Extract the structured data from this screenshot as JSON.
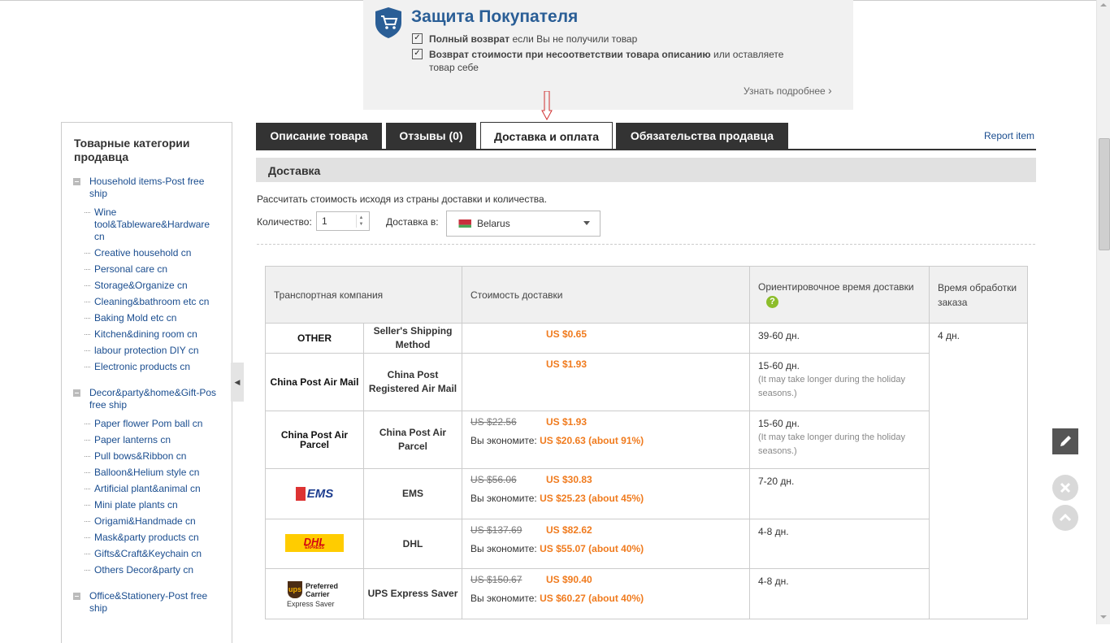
{
  "protection": {
    "title": "Защита Покупателя",
    "line1_bold": "Полный возврат",
    "line1_rest": " если Вы не получили товар",
    "line2_bold": "Возврат стоимости при несоответствии товара описанию",
    "line2_rest": " или оставляете товар себе",
    "more": "Узнать подробнее",
    "more_arrow": "›"
  },
  "sidebar": {
    "title": "Товарные категории продавца",
    "groups": [
      {
        "label": "Household items-Post free ship",
        "items": [
          "Wine tool&Tableware&Hardware cn",
          "Creative household cn",
          "Personal care cn",
          "Storage&Organize cn",
          "Cleaning&bathroom etc cn",
          "Baking Mold etc cn",
          "Kitchen&dining room cn",
          "labour protection DIY cn",
          "Electronic products cn"
        ]
      },
      {
        "label": "Decor&party&home&Gift-Pos free ship",
        "items": [
          "Paper flower Pom ball cn",
          "Paper lanterns cn",
          "Pull bows&Ribbon cn",
          "Balloon&Helium style cn",
          "Artificial plant&animal cn",
          "Mini plate plants cn",
          "Origami&Handmade cn",
          "Mask&party products cn",
          "Gifts&Craft&Keychain cn",
          "Others Decor&party cn"
        ]
      },
      {
        "label": "Office&Stationery-Post free ship",
        "items": []
      }
    ],
    "collapse_glyph": "◀"
  },
  "tabs": [
    "Описание товара",
    "Отзывы (0)",
    "Доставка и оплата",
    "Обязательства продавца"
  ],
  "report": "Report item",
  "delivery": {
    "heading": "Доставка",
    "calc_text": "Рассчитать стоимость исходя из страны доставки и количества.",
    "qty_label": "Количество:",
    "qty_value": "1",
    "ship_to_label": "Доставка в:",
    "country": "Belarus"
  },
  "table": {
    "headers": [
      "Транспортная компания",
      "Стоимость доставки",
      "Ориентировочное время доставки",
      "Время обработки заказа"
    ],
    "processing": "4 дн.",
    "rows": [
      {
        "logo": "OTHER",
        "name": "Seller's Shipping Method",
        "orig": "",
        "price": "US $0.65",
        "save_label": "",
        "save": "",
        "time": "39-60 дн.",
        "note": ""
      },
      {
        "logo": "China Post Air Mail",
        "name": "China Post Registered Air Mail",
        "orig": "",
        "price": "US $1.93",
        "save_label": "",
        "save": "",
        "time": "15-60 дн.",
        "note": "(It may take longer during the holiday seasons.)"
      },
      {
        "logo": "China Post Air Parcel",
        "name": "China Post Air Parcel",
        "orig": "US $22.56",
        "price": "US $1.93",
        "save_label": "Вы экономите:",
        "save": "US $20.63 (about 91%)",
        "time": "15-60 дн.",
        "note": "(It may take longer during the holiday seasons.)"
      },
      {
        "logo": "EMS",
        "name": "EMS",
        "orig": "US $56.06",
        "price": "US $30.83",
        "save_label": "Вы экономите:",
        "save": "US $25.23 (about 45%)",
        "time": "7-20 дн.",
        "note": ""
      },
      {
        "logo": "DHL",
        "name": "DHL",
        "orig": "US $137.69",
        "price": "US $82.62",
        "save_label": "Вы экономите:",
        "save": "US $55.07 (about 40%)",
        "time": "4-8 дн.",
        "note": ""
      },
      {
        "logo": "UPS",
        "name": "UPS Express Saver",
        "orig": "US $150.67",
        "price": "US $90.40",
        "save_label": "Вы экономите:",
        "save": "US $60.27 (about 40%)",
        "time": "4-8 дн.",
        "note": ""
      }
    ]
  },
  "logos": {
    "ems_text": "EMS",
    "dhl_text": "DHL",
    "dhl_sub": "EXPRESS",
    "ups_mark": "ups",
    "ups_line1": "Preferred",
    "ups_line2": "Carrier",
    "ups_line3": "Express Saver"
  },
  "help_glyph": "?",
  "colors": {
    "accent": "#f07b1e",
    "link": "#1a4d8f",
    "tab_dark": "#333333",
    "protection_blue": "#2a5e96",
    "help_green": "#8cbd2b"
  }
}
